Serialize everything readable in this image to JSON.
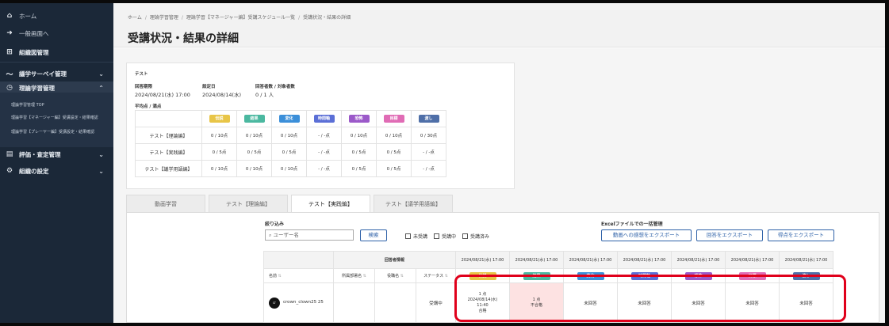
{
  "sidebar": {
    "items": [
      {
        "label": "ホーム",
        "icon": "home-icon"
      },
      {
        "label": "一般画面へ",
        "icon": "circle-arrow-icon"
      },
      {
        "label": "組織図管理",
        "icon": "org-chart-icon"
      },
      {
        "label": "議学サーベイ管理",
        "icon": "trend-icon"
      },
      {
        "label": "理論学習管理",
        "icon": "clock-icon"
      },
      {
        "label": "評価・査定管理",
        "icon": "document-icon"
      },
      {
        "label": "組織の設定",
        "icon": "gears-icon"
      }
    ],
    "sub_items": [
      "理論学習管理 TOP",
      "理論学習【マネージャー編】受講設定・結果確認",
      "理論学習【プレーヤー編】受講設定・結果確認"
    ]
  },
  "breadcrumb": [
    "ホーム",
    "理論学習管理",
    "理論学習【マネージャー編】受講スケジュール一覧",
    "受講状況・結果の詳細"
  ],
  "page_title": "受講状況・結果の詳細",
  "summary": {
    "test_name": "テスト",
    "deadline_label": "回答期限",
    "deadline_value": "2024/08/21(水) 17:00",
    "set_date_label": "設定日",
    "set_date_value": "2024/08/14(水)",
    "count_label": "回答者数 / 対象者数",
    "count_value": "0 / 1 人",
    "avg_label": "平均点 / 満点"
  },
  "categories": [
    {
      "label": "伝説",
      "color": "#e8c547"
    },
    {
      "label": "結果",
      "color": "#4bb8a0"
    },
    {
      "label": "変化",
      "color": "#3b8fd9"
    },
    {
      "label": "時間軸",
      "color": "#5b6fd6"
    },
    {
      "label": "恐怖",
      "color": "#9b59c9"
    },
    {
      "label": "目標",
      "color": "#e06cb5"
    },
    {
      "label": "渡し",
      "color": "#4f6fa8"
    }
  ],
  "score_rows": [
    {
      "label": "テスト【理論編】",
      "cells": [
        "0 / 10点",
        "0 / 10点",
        "0 / 10点",
        "- / -点",
        "0 / 10点",
        "0 / 10点",
        "0 / 30点"
      ]
    },
    {
      "label": "テスト【実践編】",
      "cells": [
        "0 / 5点",
        "0 / 5点",
        "0 / 5点",
        "- / -点",
        "0 / 5点",
        "0 / 5点",
        "- / -点"
      ]
    },
    {
      "label": "テスト【議学用語編】",
      "cells": [
        "0 / 10点",
        "0 / 10点",
        "0 / 10点",
        "- / -点",
        "0 / 5点",
        "0 / 5点",
        "- / -点"
      ]
    }
  ],
  "tabs": [
    "動画学習",
    "テスト【理論編】",
    "テスト【実践編】",
    "テスト【議学用語編】"
  ],
  "filter": {
    "label": "絞り込み",
    "search_placeholder": "ユーザー名",
    "search_button": "検索",
    "checkboxes": [
      "未受講",
      "受講中",
      "受講済み"
    ]
  },
  "export": {
    "label": "Excelファイルでの一括管理",
    "buttons": [
      "動画への感想をエクスポート",
      "回答をエクスポート",
      "得点をエクスポート"
    ]
  },
  "result_table": {
    "group_header": "回答者情報",
    "columns": [
      "名前",
      "所属部署名",
      "役職名",
      "ステータス"
    ],
    "date_header": "2024/08/21(水) 17:00",
    "row": {
      "name": "crown_clown25 25",
      "avatar": "cr",
      "dept": "",
      "role": "",
      "status": "受講中",
      "first_cell": [
        "1 点",
        "2024/08/14(水)",
        "11:40",
        "合格"
      ],
      "second_cell": [
        "1 点",
        "不合格"
      ],
      "unanswered": "未回答"
    }
  }
}
